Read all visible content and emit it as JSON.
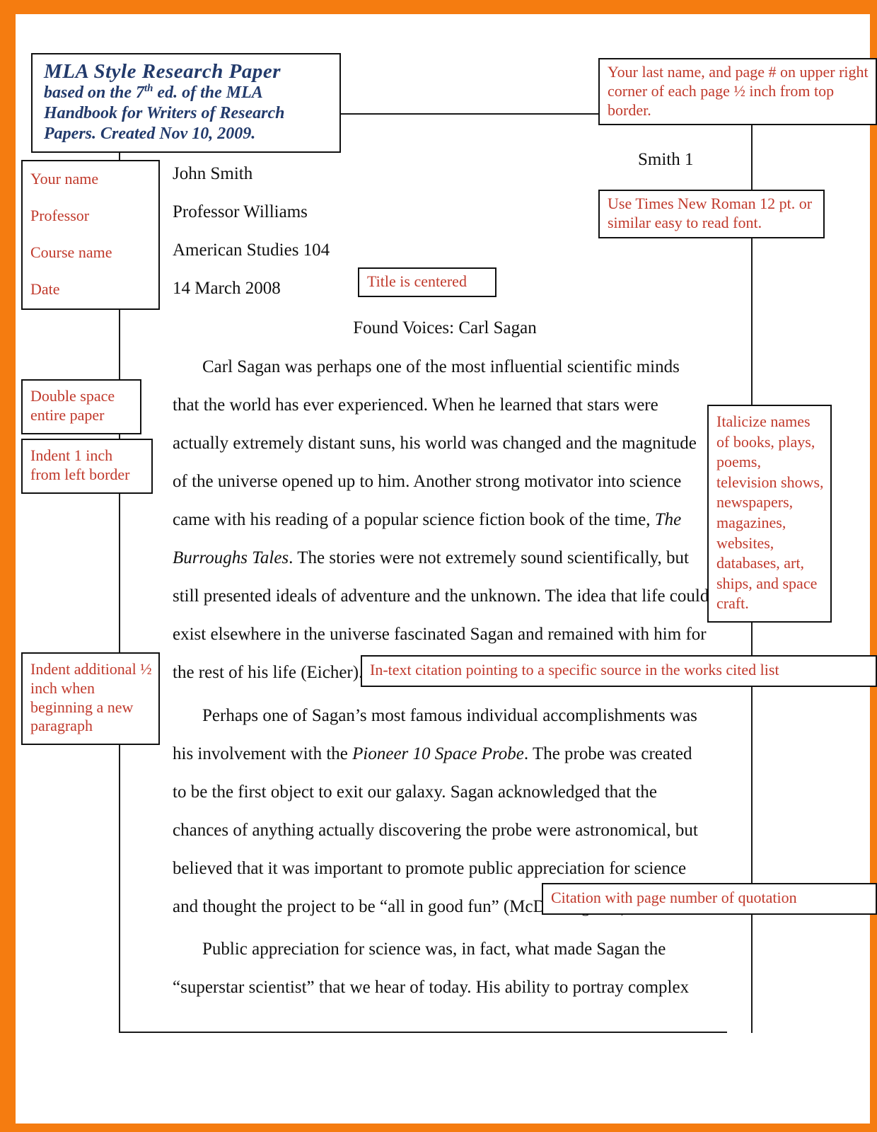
{
  "frame": {
    "border_color": "#f57c10",
    "page_background": "#ffffff"
  },
  "colors": {
    "annotation_text": "#c0392b",
    "annotation_border": "#111111",
    "title_text": "#223a6b",
    "paper_text": "#111111",
    "frame_orange": "#f57c10"
  },
  "title_box": {
    "heading": "MLA Style Research Paper",
    "sub_line_1_pre": "based on the 7",
    "sub_line_1_sup": "th",
    "sub_line_1_post": " ed. of the MLA",
    "sub_line_2": "Handbook for Writers of Research",
    "sub_line_3": "Papers. Created Nov 10, 2009."
  },
  "annotations": {
    "header_page_number": "Your last name, and page # on upper right corner of each page ½ inch from top border.",
    "font_rule": "Use Times New Roman 12 pt. or similar easy to read font.",
    "title_centered": "Title is centered",
    "heading_block": {
      "line1": "Your name",
      "line2": "Professor",
      "line3": "Course name",
      "line4": "Date"
    },
    "double_space": "Double space entire paper",
    "indent_one_inch": "Indent 1 inch from left border",
    "indent_half_inch": "Indent additional ½ inch when beginning a new paragraph",
    "italicize": "Italicize names of books, plays, poems, television shows, newspapers, magazines, websites, databases, art, ships, and space craft.",
    "in_text_citation": "In-text citation pointing to a specific source in the works cited list",
    "citation_page_number": "Citation with page number of quotation"
  },
  "paper": {
    "student_name": "John Smith",
    "professor": "Professor Williams",
    "course": "American Studies 104",
    "date": "14 March 2008",
    "running_head": "Smith 1",
    "title": "Found Voices: Carl Sagan",
    "paragraphs": [
      {
        "id": "p1",
        "segments": [
          {
            "type": "indent"
          },
          {
            "type": "text",
            "value": "Carl Sagan was perhaps one of the most influential scientific minds that the world has ever experienced. When he learned that stars were actually extremely distant suns, his world was changed and the magnitude of the universe opened up to him. Another strong motivator into science came with his reading of a popular science fiction book of the time, "
          },
          {
            "type": "italic",
            "value": "The Burroughs Tales"
          },
          {
            "type": "text",
            "value": ". The stories were not extremely sound scientifically, but still presented ideals of adventure and the unknown. The idea that life could exist elsewhere in the universe fascinated Sagan and remained with him for the rest of his life (Eicher)."
          }
        ]
      },
      {
        "id": "p2",
        "segments": [
          {
            "type": "indent"
          },
          {
            "type": "text",
            "value": "Perhaps one of Sagan’s most famous individual accomplishments was his involvement with the "
          },
          {
            "type": "italic",
            "value": "Pioneer 10 Space Probe"
          },
          {
            "type": "text",
            "value": ". The probe was created to be the first object to exit our galaxy. Sagan acknowledged that the chances of anything actually discovering the probe were astronomical, but believed that it was important to promote public appreciation for science and thought the project to be “all in good fun” (McDonough 50)."
          }
        ]
      },
      {
        "id": "p3",
        "segments": [
          {
            "type": "indent"
          },
          {
            "type": "text",
            "value": "Public appreciation for science was, in fact, what made Sagan the “superstar scientist” that we hear of today. His ability to portray complex"
          }
        ]
      }
    ]
  }
}
